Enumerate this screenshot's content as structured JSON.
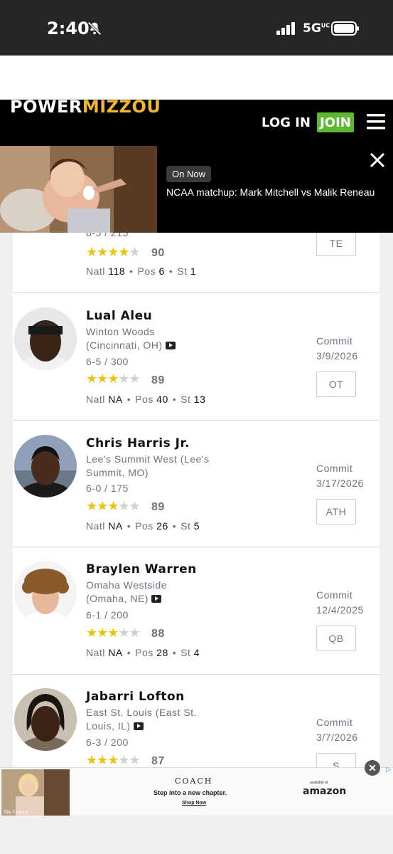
{
  "status": {
    "time": "2:40",
    "network": "5G",
    "network_sup": "UC"
  },
  "header": {
    "logo_part1": "POWER",
    "logo_part2": "MIZZOU",
    "login": "LOG IN",
    "join": "JOIN"
  },
  "video": {
    "badge": "On Now",
    "title": "NCAA matchup: Mark Mitchell vs Malik Reneau"
  },
  "partial": {
    "size": "6-5 / 215",
    "stars": 4,
    "rating": "90",
    "natl": "118",
    "pos": "6",
    "st": "1",
    "position": "TE"
  },
  "labels": {
    "natl": "Natl",
    "pos": "Pos",
    "st": "St",
    "commit": "Commit"
  },
  "recruits": [
    {
      "name": "Lual Aleu",
      "school": "Winton Woods (Cincinnati, OH)",
      "size": "6-5 / 300",
      "stars": 3,
      "rating": "89",
      "natl": "NA",
      "pos": "40",
      "st": "13",
      "commit_date": "3/9/2026",
      "position": "OT"
    },
    {
      "name": "Chris Harris Jr.",
      "school": "Lee's Summit West (Lee's Summit, MO)",
      "size": "6-0 / 175",
      "stars": 3,
      "rating": "89",
      "natl": "NA",
      "pos": "26",
      "st": "5",
      "commit_date": "3/17/2026",
      "position": "ATH"
    },
    {
      "name": "Braylen Warren",
      "school": "Omaha Westside (Omaha, NE)",
      "size": "6-1 / 200",
      "stars": 3,
      "rating": "88",
      "natl": "NA",
      "pos": "28",
      "st": "4",
      "commit_date": "12/4/2025",
      "position": "QB"
    },
    {
      "name": "Jabarri Lofton",
      "school": "East St. Louis (East St. Louis, IL)",
      "size": "6-3 / 200",
      "stars": 3,
      "rating": "87",
      "commit_date": "3/7/2026",
      "position": "S"
    }
  ],
  "ad": {
    "brand": "COACH",
    "tagline": "Step into a new chapter.",
    "shop": "Shop Now",
    "available": "available at",
    "store": "amazon",
    "image_caption": "Elle Fanning"
  },
  "colors": {
    "brand_gold": "#f1b82d",
    "join_green": "#5cb82e",
    "star": "#e6c50e"
  }
}
